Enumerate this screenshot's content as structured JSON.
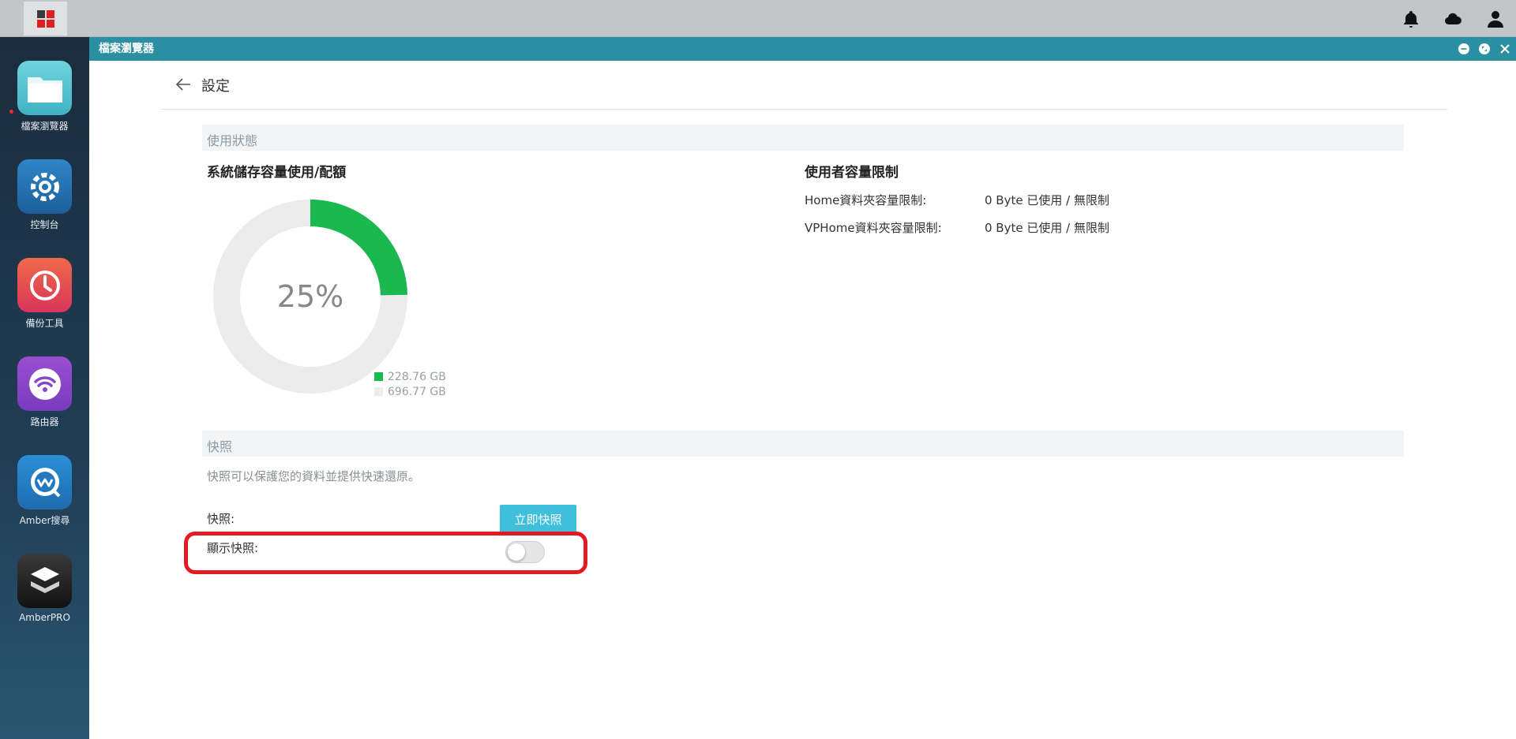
{
  "dock": {
    "items": [
      {
        "label": "檔案瀏覽器",
        "icon": "folder-icon"
      },
      {
        "label": "控制台",
        "icon": "gear-icon"
      },
      {
        "label": "備份工具",
        "icon": "history-clock-icon"
      },
      {
        "label": "路由器",
        "icon": "wifi-icon"
      },
      {
        "label": "Amber搜尋",
        "icon": "search-bubble-icon"
      },
      {
        "label": "AmberPRO",
        "icon": "cube-icon"
      }
    ]
  },
  "window": {
    "title": "檔案瀏覽器"
  },
  "header": {
    "title": "設定"
  },
  "usage": {
    "section_title": "使用狀態",
    "storage_title": "系統儲存容量使用/配額",
    "quota_title": "使用者容量限制",
    "quota_rows": [
      {
        "label": "Home資料夾容量限制:",
        "value": "0 Byte 已使用 / 無限制"
      },
      {
        "label": "VPHome資料夾容量限制:",
        "value": "0 Byte 已使用 / 無限制"
      }
    ]
  },
  "chart_data": {
    "type": "pie",
    "center_label": "25%",
    "slices": [
      {
        "label": "228.76 GB",
        "value": 228.76,
        "color": "#1ab84e"
      },
      {
        "label": "696.77 GB",
        "value": 696.77,
        "color": "#ececec"
      }
    ]
  },
  "snapshot": {
    "section_title": "快照",
    "description": "快照可以保護您的資料並提供快速還原。",
    "snapshot_label": "快照:",
    "snapshot_button": "立即快照",
    "show_label": "顯示快照:",
    "show_enabled": false
  },
  "colors": {
    "accent": "#2a8fa3",
    "button": "#3fbfdc",
    "highlight": "#e11b24"
  }
}
